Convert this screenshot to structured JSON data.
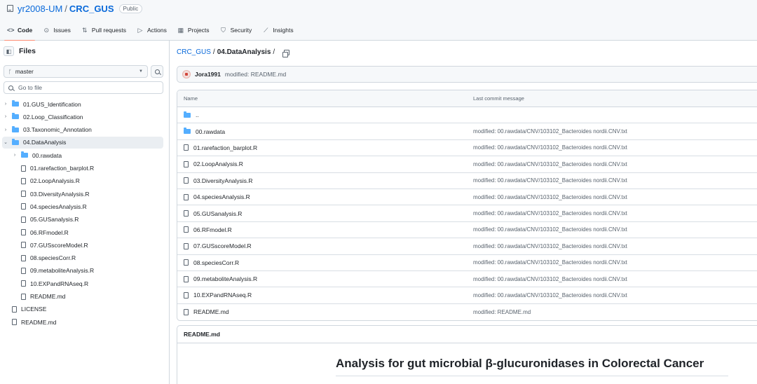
{
  "header": {
    "owner": "yr2008-UM",
    "separator": "/",
    "repo": "CRC_GUS",
    "visibility": "Public",
    "tabs": [
      {
        "label": "Code",
        "icon": "code-icon"
      },
      {
        "label": "Issues",
        "icon": "issues-icon"
      },
      {
        "label": "Pull requests",
        "icon": "pull-request-icon"
      },
      {
        "label": "Actions",
        "icon": "actions-icon"
      },
      {
        "label": "Projects",
        "icon": "projects-icon"
      },
      {
        "label": "Security",
        "icon": "shield-icon"
      },
      {
        "label": "Insights",
        "icon": "graph-icon"
      }
    ]
  },
  "sidebar": {
    "title": "Files",
    "branch": "master",
    "goto_placeholder": "Go to file",
    "tree": [
      {
        "label": "01.GUS_Identification",
        "type": "folder",
        "depth": 0,
        "expanded": false
      },
      {
        "label": "02.Loop_Classification",
        "type": "folder",
        "depth": 0,
        "expanded": false
      },
      {
        "label": "03.Taxonomic_Annotation",
        "type": "folder",
        "depth": 0,
        "expanded": false
      },
      {
        "label": "04.DataAnalysis",
        "type": "folder",
        "depth": 0,
        "expanded": true
      },
      {
        "label": "00.rawdata",
        "type": "folder",
        "depth": 1,
        "expanded": false
      },
      {
        "label": "01.rarefaction_barplot.R",
        "type": "file",
        "depth": 1
      },
      {
        "label": "02.LoopAnalysis.R",
        "type": "file",
        "depth": 1
      },
      {
        "label": "03.DiversityAnalysis.R",
        "type": "file",
        "depth": 1
      },
      {
        "label": "04.speciesAnalysis.R",
        "type": "file",
        "depth": 1
      },
      {
        "label": "05.GUSanalysis.R",
        "type": "file",
        "depth": 1
      },
      {
        "label": "06.RFmodel.R",
        "type": "file",
        "depth": 1
      },
      {
        "label": "07.GUSscoreModel.R",
        "type": "file",
        "depth": 1
      },
      {
        "label": "08.speciesCorr.R",
        "type": "file",
        "depth": 1
      },
      {
        "label": "09.metaboliteAnalysis.R",
        "type": "file",
        "depth": 1
      },
      {
        "label": "10.EXPandRNAseq.R",
        "type": "file",
        "depth": 1
      },
      {
        "label": "README.md",
        "type": "file",
        "depth": 1
      },
      {
        "label": "LICENSE",
        "type": "file",
        "depth": 0
      },
      {
        "label": "README.md",
        "type": "file",
        "depth": 0
      }
    ]
  },
  "main": {
    "breadcrumb": {
      "root": "CRC_GUS",
      "sep": "/",
      "current": "04.DataAnalysis",
      "trail": "/"
    },
    "latest_commit": {
      "author": "Jora1991",
      "message": "modified: README.md"
    },
    "table": {
      "col_name": "Name",
      "col_message": "Last commit message",
      "rows": [
        {
          "name": "..",
          "type": "folder",
          "message": ""
        },
        {
          "name": "00.rawdata",
          "type": "folder",
          "message": "modified: 00.rawdata/CNV/103102_Bacteroides nordii.CNV.txt"
        },
        {
          "name": "01.rarefaction_barplot.R",
          "type": "file",
          "message": "modified: 00.rawdata/CNV/103102_Bacteroides nordii.CNV.txt"
        },
        {
          "name": "02.LoopAnalysis.R",
          "type": "file",
          "message": "modified: 00.rawdata/CNV/103102_Bacteroides nordii.CNV.txt"
        },
        {
          "name": "03.DiversityAnalysis.R",
          "type": "file",
          "message": "modified: 00.rawdata/CNV/103102_Bacteroides nordii.CNV.txt"
        },
        {
          "name": "04.speciesAnalysis.R",
          "type": "file",
          "message": "modified: 00.rawdata/CNV/103102_Bacteroides nordii.CNV.txt"
        },
        {
          "name": "05.GUSanalysis.R",
          "type": "file",
          "message": "modified: 00.rawdata/CNV/103102_Bacteroides nordii.CNV.txt"
        },
        {
          "name": "06.RFmodel.R",
          "type": "file",
          "message": "modified: 00.rawdata/CNV/103102_Bacteroides nordii.CNV.txt"
        },
        {
          "name": "07.GUSscoreModel.R",
          "type": "file",
          "message": "modified: 00.rawdata/CNV/103102_Bacteroides nordii.CNV.txt"
        },
        {
          "name": "08.speciesCorr.R",
          "type": "file",
          "message": "modified: 00.rawdata/CNV/103102_Bacteroides nordii.CNV.txt"
        },
        {
          "name": "09.metaboliteAnalysis.R",
          "type": "file",
          "message": "modified: 00.rawdata/CNV/103102_Bacteroides nordii.CNV.txt"
        },
        {
          "name": "10.EXPandRNAseq.R",
          "type": "file",
          "message": "modified: 00.rawdata/CNV/103102_Bacteroides nordii.CNV.txt"
        },
        {
          "name": "README.md",
          "type": "file",
          "message": "modified: README.md"
        }
      ]
    },
    "readme": {
      "filename": "README.md",
      "heading": "Analysis for gut microbial β-glucuronidases in Colorectal Cancer"
    }
  }
}
